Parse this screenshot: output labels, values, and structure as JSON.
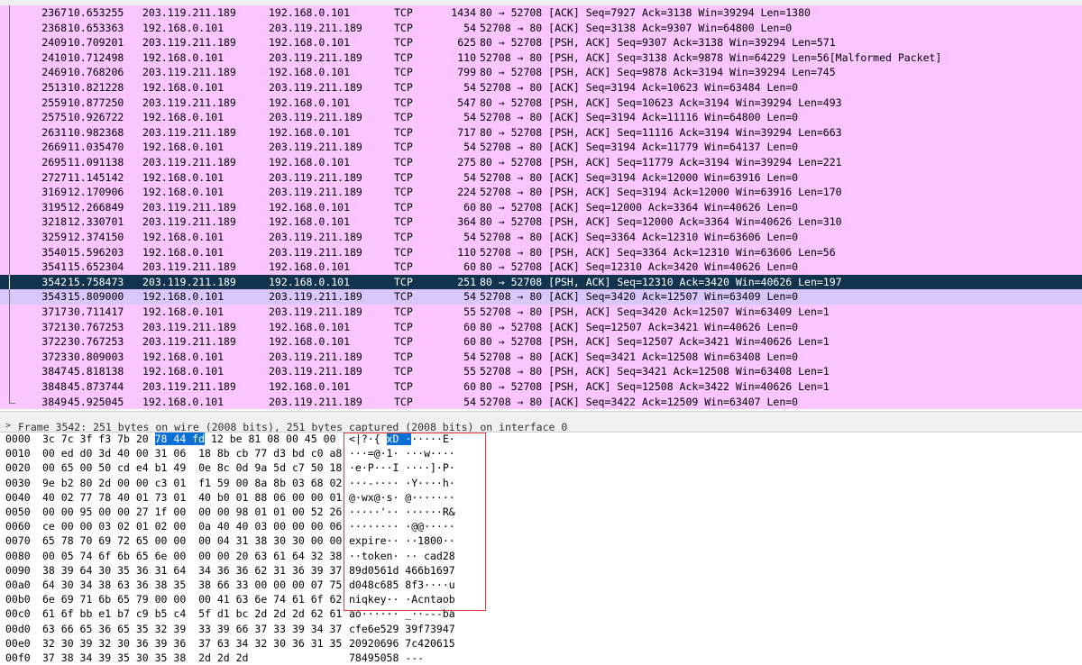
{
  "packets": [
    {
      "no": "2367",
      "time": "10.653255",
      "src": "203.119.211.189",
      "dst": "192.168.0.101",
      "proto": "TCP",
      "len": "1434",
      "info": "80 → 52708 [ACK] Seq=7927 Ack=3138 Win=39294 Len=1380"
    },
    {
      "no": "2368",
      "time": "10.653363",
      "src": "192.168.0.101",
      "dst": "203.119.211.189",
      "proto": "TCP",
      "len": "54",
      "info": "52708 → 80 [ACK] Seq=3138 Ack=9307 Win=64800 Len=0"
    },
    {
      "no": "2409",
      "time": "10.709201",
      "src": "203.119.211.189",
      "dst": "192.168.0.101",
      "proto": "TCP",
      "len": "625",
      "info": "80 → 52708 [PSH, ACK] Seq=9307 Ack=3138 Win=39294 Len=571"
    },
    {
      "no": "2410",
      "time": "10.712498",
      "src": "192.168.0.101",
      "dst": "203.119.211.189",
      "proto": "TCP",
      "len": "110",
      "info": "52708 → 80 [PSH, ACK] Seq=3138 Ack=9878 Win=64229 Len=56[Malformed Packet]"
    },
    {
      "no": "2469",
      "time": "10.768206",
      "src": "203.119.211.189",
      "dst": "192.168.0.101",
      "proto": "TCP",
      "len": "799",
      "info": "80 → 52708 [PSH, ACK] Seq=9878 Ack=3194 Win=39294 Len=745"
    },
    {
      "no": "2513",
      "time": "10.821228",
      "src": "192.168.0.101",
      "dst": "203.119.211.189",
      "proto": "TCP",
      "len": "54",
      "info": "52708 → 80 [ACK] Seq=3194 Ack=10623 Win=63484 Len=0"
    },
    {
      "no": "2559",
      "time": "10.877250",
      "src": "203.119.211.189",
      "dst": "192.168.0.101",
      "proto": "TCP",
      "len": "547",
      "info": "80 → 52708 [PSH, ACK] Seq=10623 Ack=3194 Win=39294 Len=493"
    },
    {
      "no": "2575",
      "time": "10.926722",
      "src": "192.168.0.101",
      "dst": "203.119.211.189",
      "proto": "TCP",
      "len": "54",
      "info": "52708 → 80 [ACK] Seq=3194 Ack=11116 Win=64800 Len=0"
    },
    {
      "no": "2631",
      "time": "10.982368",
      "src": "203.119.211.189",
      "dst": "192.168.0.101",
      "proto": "TCP",
      "len": "717",
      "info": "80 → 52708 [PSH, ACK] Seq=11116 Ack=3194 Win=39294 Len=663"
    },
    {
      "no": "2669",
      "time": "11.035470",
      "src": "192.168.0.101",
      "dst": "203.119.211.189",
      "proto": "TCP",
      "len": "54",
      "info": "52708 → 80 [ACK] Seq=3194 Ack=11779 Win=64137 Len=0"
    },
    {
      "no": "2695",
      "time": "11.091138",
      "src": "203.119.211.189",
      "dst": "192.168.0.101",
      "proto": "TCP",
      "len": "275",
      "info": "80 → 52708 [PSH, ACK] Seq=11779 Ack=3194 Win=39294 Len=221"
    },
    {
      "no": "2727",
      "time": "11.145142",
      "src": "192.168.0.101",
      "dst": "203.119.211.189",
      "proto": "TCP",
      "len": "54",
      "info": "52708 → 80 [ACK] Seq=3194 Ack=12000 Win=63916 Len=0"
    },
    {
      "no": "3169",
      "time": "12.170906",
      "src": "192.168.0.101",
      "dst": "203.119.211.189",
      "proto": "TCP",
      "len": "224",
      "info": "52708 → 80 [PSH, ACK] Seq=3194 Ack=12000 Win=63916 Len=170"
    },
    {
      "no": "3195",
      "time": "12.266849",
      "src": "203.119.211.189",
      "dst": "192.168.0.101",
      "proto": "TCP",
      "len": "60",
      "info": "80 → 52708 [ACK] Seq=12000 Ack=3364 Win=40626 Len=0"
    },
    {
      "no": "3218",
      "time": "12.330701",
      "src": "203.119.211.189",
      "dst": "192.168.0.101",
      "proto": "TCP",
      "len": "364",
      "info": "80 → 52708 [PSH, ACK] Seq=12000 Ack=3364 Win=40626 Len=310"
    },
    {
      "no": "3259",
      "time": "12.374150",
      "src": "192.168.0.101",
      "dst": "203.119.211.189",
      "proto": "TCP",
      "len": "54",
      "info": "52708 → 80 [ACK] Seq=3364 Ack=12310 Win=63606 Len=0"
    },
    {
      "no": "3540",
      "time": "15.596203",
      "src": "192.168.0.101",
      "dst": "203.119.211.189",
      "proto": "TCP",
      "len": "110",
      "info": "52708 → 80 [PSH, ACK] Seq=3364 Ack=12310 Win=63606 Len=56"
    },
    {
      "no": "3541",
      "time": "15.652304",
      "src": "203.119.211.189",
      "dst": "192.168.0.101",
      "proto": "TCP",
      "len": "60",
      "info": "80 → 52708 [ACK] Seq=12310 Ack=3420 Win=40626 Len=0"
    },
    {
      "no": "3542",
      "time": "15.758473",
      "src": "203.119.211.189",
      "dst": "192.168.0.101",
      "proto": "TCP",
      "len": "251",
      "info": "80 → 52708 [PSH, ACK] Seq=12310 Ack=3420 Win=40626 Len=197",
      "selected": true
    },
    {
      "no": "3543",
      "time": "15.809000",
      "src": "192.168.0.101",
      "dst": "203.119.211.189",
      "proto": "TCP",
      "len": "54",
      "info": "52708 → 80 [ACK] Seq=3420 Ack=12507 Win=63409 Len=0",
      "related": true
    },
    {
      "no": "3717",
      "time": "30.711417",
      "src": "192.168.0.101",
      "dst": "203.119.211.189",
      "proto": "TCP",
      "len": "55",
      "info": "52708 → 80 [PSH, ACK] Seq=3420 Ack=12507 Win=63409 Len=1"
    },
    {
      "no": "3721",
      "time": "30.767253",
      "src": "203.119.211.189",
      "dst": "192.168.0.101",
      "proto": "TCP",
      "len": "60",
      "info": "80 → 52708 [ACK] Seq=12507 Ack=3421 Win=40626 Len=0"
    },
    {
      "no": "3722",
      "time": "30.767253",
      "src": "203.119.211.189",
      "dst": "192.168.0.101",
      "proto": "TCP",
      "len": "60",
      "info": "80 → 52708 [PSH, ACK] Seq=12507 Ack=3421 Win=40626 Len=1"
    },
    {
      "no": "3723",
      "time": "30.809003",
      "src": "192.168.0.101",
      "dst": "203.119.211.189",
      "proto": "TCP",
      "len": "54",
      "info": "52708 → 80 [ACK] Seq=3421 Ack=12508 Win=63408 Len=0"
    },
    {
      "no": "3847",
      "time": "45.818138",
      "src": "192.168.0.101",
      "dst": "203.119.211.189",
      "proto": "TCP",
      "len": "55",
      "info": "52708 → 80 [PSH, ACK] Seq=3421 Ack=12508 Win=63408 Len=1"
    },
    {
      "no": "3848",
      "time": "45.873744",
      "src": "203.119.211.189",
      "dst": "192.168.0.101",
      "proto": "TCP",
      "len": "60",
      "info": "80 → 52708 [PSH, ACK] Seq=12508 Ack=3422 Win=40626 Len=1"
    },
    {
      "no": "3849",
      "time": "45.925045",
      "src": "192.168.0.101",
      "dst": "203.119.211.189",
      "proto": "TCP",
      "len": "54",
      "info": "52708 → 80 [ACK] Seq=3422 Ack=12509 Win=63407 Len=0"
    }
  ],
  "detail_line": "Frame 3542: 251 bytes on wire (2008 bits), 251 bytes captured (2008 bits) on interface 0",
  "bytes": [
    {
      "offset": "0000",
      "hex_a": "3c 7c 3f f3 7b 20 ",
      "hex_hl": "78 44 fd",
      "hex_b": " 12 be 81 08 00 45 00",
      "ascii_a": "<|?·{ ",
      "ascii_hl": "xD ·",
      "ascii_b": "·····E·"
    },
    {
      "offset": "0010",
      "hex": "00 ed d0 3d 40 00 31 06  18 8b cb 77 d3 bd c0 a8",
      "ascii": "···=@·1· ···w····"
    },
    {
      "offset": "0020",
      "hex": "00 65 00 50 cd e4 b1 49  0e 8c 0d 9a 5d c7 50 18",
      "ascii": "·e·P···I ····]·P·"
    },
    {
      "offset": "0030",
      "hex": "9e b2 80 2d 00 00 c3 01  f1 59 00 8a 8b 03 68 02",
      "ascii": "···-···· ·Y····h·"
    },
    {
      "offset": "0040",
      "hex": "40 02 77 78 40 01 73 01  40 b0 01 88 06 00 00 01",
      "ascii": "@·wx@·s· @·······"
    },
    {
      "offset": "0050",
      "hex": "00 00 95 00 00 27 1f 00  00 00 98 01 01 00 52 26",
      "ascii": "·····'·· ······R&"
    },
    {
      "offset": "0060",
      "hex": "ce 00 00 03 02 01 02 00  0a 40 40 03 00 00 00 06",
      "ascii": "········ ·@@·····"
    },
    {
      "offset": "0070",
      "hex": "65 78 70 69 72 65 00 00  00 04 31 38 30 30 00 00",
      "ascii": "expire·· ··1800··"
    },
    {
      "offset": "0080",
      "hex": "00 05 74 6f 6b 65 6e 00  00 00 20 63 61 64 32 38",
      "ascii": "··token· ·· cad28"
    },
    {
      "offset": "0090",
      "hex": "38 39 64 30 35 36 31 64  34 36 36 62 31 36 39 37",
      "ascii": "89d0561d 466b1697"
    },
    {
      "offset": "00a0",
      "hex": "64 30 34 38 63 36 38 35  38 66 33 00 00 00 07 75",
      "ascii": "d048c685 8f3····u"
    },
    {
      "offset": "00b0",
      "hex": "6e 69 71 6b 65 79 00 00  00 41 63 6e 74 61 6f 62",
      "ascii": "niqkey·· ·Acntaob"
    },
    {
      "offset": "00c0",
      "hex": "61 6f bb e1 b7 c9 b5 c4  5f d1 bc 2d 2d 2d 62 61",
      "ascii": "ao······ _··---ba"
    },
    {
      "offset": "00d0",
      "hex": "63 66 65 36 65 35 32 39  33 39 66 37 33 39 34 37",
      "ascii": "cfe6e529 39f73947"
    },
    {
      "offset": "00e0",
      "hex": "32 30 39 32 30 36 39 36  37 63 34 32 30 36 31 35",
      "ascii": "20920696 7c420615"
    },
    {
      "offset": "00f0",
      "hex": "37 38 34 39 35 30 35 38  2d 2d 2d",
      "ascii": "78495058 ---"
    }
  ],
  "colors": {
    "row_bg": "#fbc5ff",
    "selected_bg": "#12334d",
    "related_bg": "#d9c6fb",
    "highlight": "#0a6fd6",
    "annotation_box": "#e33c3c"
  }
}
